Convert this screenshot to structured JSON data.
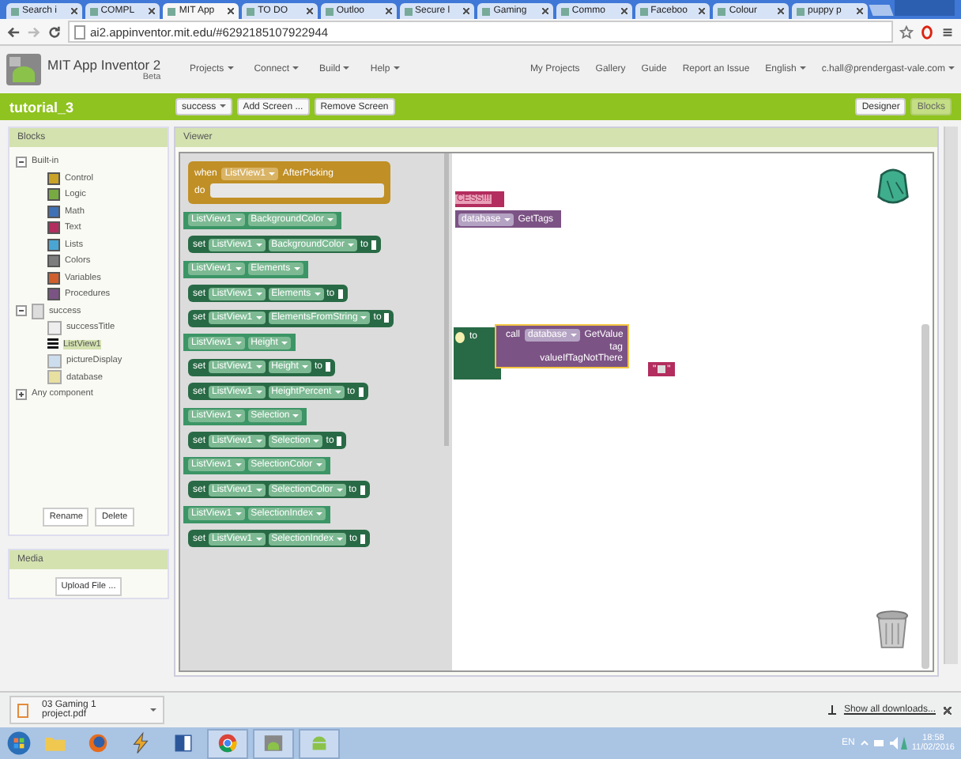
{
  "browser": {
    "tabs": [
      {
        "label": "Search i",
        "selected": false
      },
      {
        "label": "COMPL",
        "selected": false
      },
      {
        "label": "MIT App",
        "selected": true
      },
      {
        "label": "TO DO",
        "selected": false
      },
      {
        "label": "Outloo",
        "selected": false
      },
      {
        "label": "Secure l",
        "selected": false
      },
      {
        "label": "Gaming",
        "selected": false
      },
      {
        "label": "Commo",
        "selected": false
      },
      {
        "label": "Faceboo",
        "selected": false
      },
      {
        "label": "Colour",
        "selected": false
      },
      {
        "label": "puppy p",
        "selected": false
      }
    ],
    "url": "ai2.appinventor.mit.edu/#6292185107922944"
  },
  "app": {
    "title": "MIT App Inventor 2",
    "subtitle": "Beta",
    "menus": [
      "Projects",
      "Connect",
      "Build",
      "Help"
    ],
    "links": [
      "My Projects",
      "Gallery",
      "Guide",
      "Report an Issue"
    ],
    "language": "English",
    "user": "c.hall@prendergast-vale.com"
  },
  "project": {
    "name": "tutorial_3",
    "screen": "success",
    "buttons": [
      "Add Screen ...",
      "Remove Screen"
    ],
    "modes": [
      {
        "label": "Designer",
        "selected": false
      },
      {
        "label": "Blocks",
        "selected": true
      }
    ]
  },
  "blocks_panel": {
    "title": "Blocks",
    "builtin": {
      "label": "Built-in",
      "expanded": true,
      "children": [
        {
          "label": "Control",
          "color": "#c9a227"
        },
        {
          "label": "Logic",
          "color": "#77ab41"
        },
        {
          "label": "Math",
          "color": "#3f71b5"
        },
        {
          "label": "Text",
          "color": "#b32d5e"
        },
        {
          "label": "Lists",
          "color": "#49a6d4"
        },
        {
          "label": "Colors",
          "color": "#7d7d7d"
        },
        {
          "label": "Variables",
          "color": "#d05f2d"
        },
        {
          "label": "Procedures",
          "color": "#7c5385"
        }
      ]
    },
    "screen": {
      "label": "success",
      "expanded": true,
      "children": [
        {
          "label": "successTitle",
          "kind": "label",
          "selected": false
        },
        {
          "label": "ListView1",
          "kind": "listview",
          "selected": true
        },
        {
          "label": "pictureDisplay",
          "kind": "image",
          "selected": false
        },
        {
          "label": "database",
          "kind": "db",
          "selected": false
        }
      ]
    },
    "any": {
      "label": "Any component",
      "expanded": false
    },
    "buttons": [
      "Rename",
      "Delete"
    ]
  },
  "media": {
    "title": "Media",
    "button": "Upload File ..."
  },
  "viewer": {
    "title": "Viewer",
    "drawer": [
      {
        "kind": "event",
        "keyword": "when",
        "component": "ListView1",
        "event": "AfterPicking",
        "body": "do"
      },
      {
        "kind": "getter",
        "component": "ListView1",
        "property": "BackgroundColor"
      },
      {
        "kind": "setter",
        "keyword": "set",
        "component": "ListView1",
        "property": "BackgroundColor",
        "suffix": "to"
      },
      {
        "kind": "getter",
        "component": "ListView1",
        "property": "Elements"
      },
      {
        "kind": "setter",
        "keyword": "set",
        "component": "ListView1",
        "property": "Elements",
        "suffix": "to"
      },
      {
        "kind": "setter",
        "keyword": "set",
        "component": "ListView1",
        "property": "ElementsFromString",
        "suffix": "to"
      },
      {
        "kind": "getter",
        "component": "ListView1",
        "property": "Height"
      },
      {
        "kind": "setter",
        "keyword": "set",
        "component": "ListView1",
        "property": "Height",
        "suffix": "to"
      },
      {
        "kind": "setter",
        "keyword": "set",
        "component": "ListView1",
        "property": "HeightPercent",
        "suffix": "to"
      },
      {
        "kind": "getter",
        "component": "ListView1",
        "property": "Selection"
      },
      {
        "kind": "setter",
        "keyword": "set",
        "component": "ListView1",
        "property": "Selection",
        "suffix": "to"
      },
      {
        "kind": "getter",
        "component": "ListView1",
        "property": "SelectionColor"
      },
      {
        "kind": "setter",
        "keyword": "set",
        "component": "ListView1",
        "property": "SelectionColor",
        "suffix": "to"
      },
      {
        "kind": "getter",
        "component": "ListView1",
        "property": "SelectionIndex"
      },
      {
        "kind": "setter",
        "keyword": "set",
        "component": "ListView1",
        "property": "SelectionIndex",
        "suffix": "to"
      }
    ],
    "canvas": {
      "text_block": "CESS!!!",
      "tags_block": {
        "component": "database",
        "method": "GetTags"
      },
      "call_block": {
        "prefix": "to",
        "keyword": "call",
        "component": "database",
        "method": "GetValue",
        "args": [
          "tag",
          "valueIfTagNotThere"
        ],
        "open_quote": "\"",
        "close_quote": "\""
      }
    }
  },
  "downloads": {
    "file": "03 Gaming 1 project.pdf",
    "link": "Show all downloads..."
  },
  "taskbar": {
    "language": "EN",
    "time": "18:58",
    "date": "11/02/2016"
  }
}
